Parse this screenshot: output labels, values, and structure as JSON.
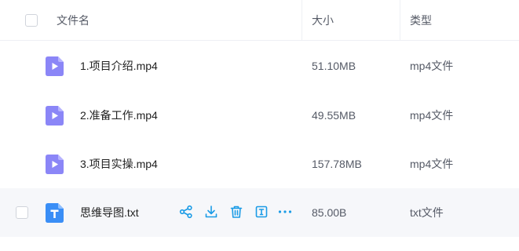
{
  "header": {
    "name_label": "文件名",
    "size_label": "大小",
    "type_label": "类型"
  },
  "rows": [
    {
      "name": "1.项目介绍.mp4",
      "size": "51.10MB",
      "type": "mp4文件",
      "icon": "video-file-icon"
    },
    {
      "name": "2.准备工作.mp4",
      "size": "49.55MB",
      "type": "mp4文件",
      "icon": "video-file-icon"
    },
    {
      "name": "3.项目实操.mp4",
      "size": "157.78MB",
      "type": "mp4文件",
      "icon": "video-file-icon"
    },
    {
      "name": "思维导图.txt",
      "size": "85.00B",
      "type": "txt文件",
      "icon": "text-file-icon"
    }
  ],
  "row_actions": [
    "share-icon",
    "download-icon",
    "delete-icon",
    "rename-icon",
    "more-icon"
  ],
  "colors": {
    "video_icon": "#8b86f7",
    "text_icon": "#3a8ef6",
    "action_icon": "#1a9be6",
    "hover_row": "#f6f7fa"
  }
}
